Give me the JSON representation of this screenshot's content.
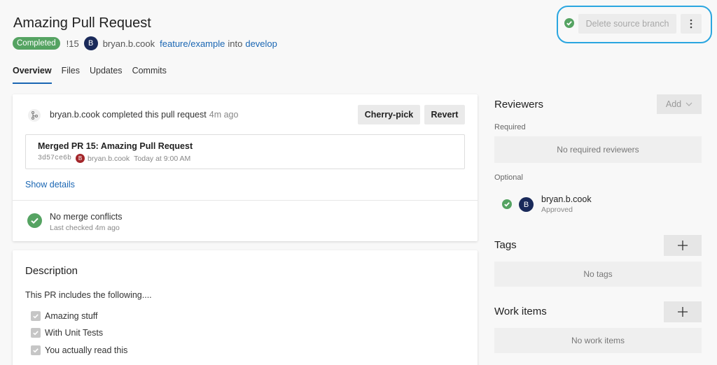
{
  "header": {
    "title": "Amazing Pull Request",
    "status_badge": "Completed",
    "pr_number": "!15",
    "avatar_initial": "B",
    "author": "bryan.b.cook",
    "source_branch": "feature/example",
    "into_label": "into",
    "target_branch": "develop"
  },
  "actions": {
    "delete_branch_label": "Delete source branch"
  },
  "tabs": [
    {
      "label": "Overview",
      "active": true
    },
    {
      "label": "Files",
      "active": false
    },
    {
      "label": "Updates",
      "active": false
    },
    {
      "label": "Commits",
      "active": false
    }
  ],
  "completion": {
    "text": "bryan.b.cook completed this pull request",
    "time": "4m ago",
    "cherry_pick_label": "Cherry-pick",
    "revert_label": "Revert",
    "merge_title": "Merged PR 15: Amazing Pull Request",
    "commit_hash": "3d57ce6b",
    "commit_avatar_initial": "B",
    "commit_author": "bryan.b.cook",
    "commit_time": "Today at 9:00 AM",
    "show_details": "Show details",
    "conflicts_title": "No merge conflicts",
    "conflicts_sub": "Last checked 4m ago"
  },
  "description": {
    "title": "Description",
    "text": "This PR includes the following....",
    "tasks": [
      {
        "label": "Amazing stuff",
        "checked": true
      },
      {
        "label": "With Unit Tests",
        "checked": true
      },
      {
        "label": "You actually read this",
        "checked": true
      }
    ]
  },
  "reviewers": {
    "title": "Reviewers",
    "add_label": "Add",
    "required_label": "Required",
    "required_empty": "No required reviewers",
    "optional_label": "Optional",
    "reviewer_initial": "B",
    "reviewer_name": "bryan.b.cook",
    "reviewer_status": "Approved"
  },
  "tags": {
    "title": "Tags",
    "empty": "No tags"
  },
  "work_items": {
    "title": "Work items",
    "empty": "No work items"
  },
  "colors": {
    "accent": "#1a66b3",
    "success": "#55a362",
    "highlight": "#2aa6e0"
  }
}
